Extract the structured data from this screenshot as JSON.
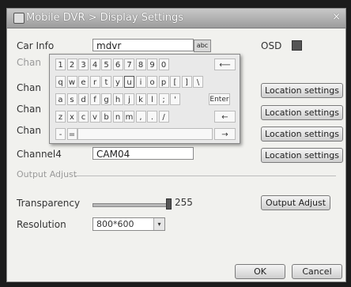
{
  "window": {
    "title": "Mobile DVR > Display Settings",
    "close": "×"
  },
  "car_info": {
    "label": "Car Info",
    "value": "mdvr",
    "abc_button": "abc"
  },
  "osd": {
    "label": "OSD",
    "checked": true
  },
  "channels_partial": [
    "Chan",
    "Chan",
    "Chan",
    "Chan",
    "Chan"
  ],
  "channel4": {
    "label": "Channel4",
    "value": "CAM04"
  },
  "location_button": "Location settings",
  "output_adjust_section": "Output Adjust",
  "transparency": {
    "label": "Transparency",
    "value": "255"
  },
  "output_adjust_button": "Output Adjust",
  "resolution": {
    "label": "Resolution",
    "value": "800*600",
    "arrow": "▾"
  },
  "footer": {
    "ok": "OK",
    "cancel": "Cancel"
  },
  "keyboard": {
    "row1": [
      "1",
      "2",
      "3",
      "4",
      "5",
      "6",
      "7",
      "8",
      "9",
      "0"
    ],
    "row2": [
      "q",
      "w",
      "e",
      "r",
      "t",
      "y",
      "u",
      "i",
      "o",
      "p",
      "[",
      "]",
      "\\"
    ],
    "row3": [
      "a",
      "s",
      "d",
      "f",
      "g",
      "h",
      "j",
      "k",
      "l",
      ";",
      "'"
    ],
    "row4": [
      "z",
      "x",
      "c",
      "v",
      "b",
      "n",
      "m",
      ",",
      ".",
      "/"
    ],
    "row5": [
      "-",
      "="
    ],
    "backspace": "⟵",
    "enter": "Enter",
    "left": "←",
    "right": "→"
  }
}
